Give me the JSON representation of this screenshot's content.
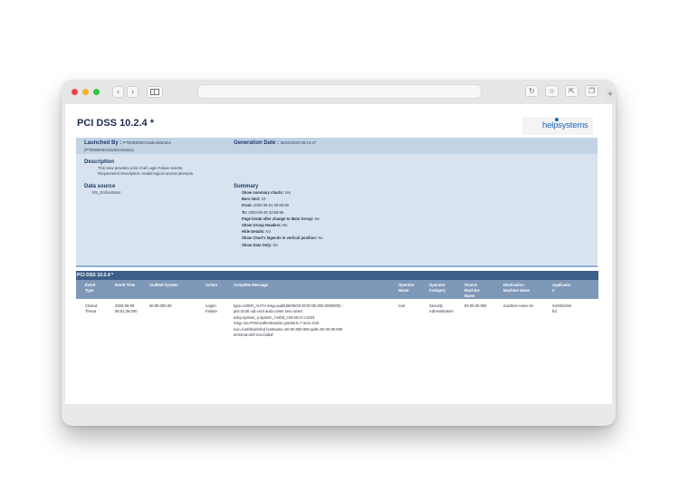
{
  "report": {
    "title": "PCI DSS 10.2.4 *",
    "logo_text": "helpsystems",
    "launched_by_label": "Launched By :",
    "launched_by_value": "PTEMDEMO1\\administrator",
    "launched_by_value2": "(PTEMDEMO1\\administrator)",
    "generation_date_label": "Generation Date :",
    "generation_date_value": "06/23/2020 09:14:47",
    "description_label": "Description",
    "description_lines": [
      "This view provides a list of all Login Failure events.",
      "Requirement Description: Invalid logical access attempts."
    ],
    "data_source_label": "Data source",
    "data_source_value": "RS_Orchestrator",
    "summary_label": "Summary",
    "summary": [
      {
        "k": "Show summary charts:",
        "v": "Yes"
      },
      {
        "k": "Bars limit:",
        "v": "10"
      },
      {
        "k": "From:",
        "v": "2020-06-01 00:00:00"
      },
      {
        "k": "To:",
        "v": "2020-06-30 23:59:59"
      },
      {
        "k": "Page break after change to Main Group:",
        "v": "No"
      },
      {
        "k": "Show Group Headers:",
        "v": "No"
      },
      {
        "k": "Hide Details:",
        "v": "No"
      },
      {
        "k": "Show Chart's legends in vertical position:",
        "v": "No"
      },
      {
        "k": "Show Data Only:",
        "v": "No"
      }
    ]
  },
  "table": {
    "section_title": "PCI DSS 10.2.4 *",
    "headers": {
      "event_type": [
        "Event",
        "Type"
      ],
      "event_time": [
        "Event Time"
      ],
      "audited_system": [
        "Audited System"
      ],
      "action": [
        "Action"
      ],
      "complete_message": [
        "Complete Message"
      ],
      "operator_name": [
        "Operator",
        "Name"
      ],
      "operator_category": [
        "Operator",
        "Category"
      ],
      "source_machine": [
        "Source",
        "Machine",
        "Name"
      ],
      "destination_machine": [
        "Destination",
        "Machine Name"
      ],
      "application": [
        "Applicatio",
        "n"
      ]
    },
    "row": {
      "event_type": [
        "Closed",
        "Threat"
      ],
      "event_time": [
        "2020-06-09",
        "06:51:36.000"
      ],
      "audited_system": [
        "00.00.000.00"
      ],
      "action": [
        "Logon",
        "Failure"
      ],
      "complete_message": [
        "type=USER_AUTH msg=audit(06/09/20 00:00:00.000.0000000) :",
        "pid=3136 uid=root auid=unset ses=unset",
        "subj=system_u:system_r:sshd_t:s0-s0:c0.c1023",
        "msg='op=PAM:authentication grantors=? acct=root",
        "exe=/usr/sbin/sshd hostname=00.00.000.000 addr=00.00.00.000",
        "terminal=ssh res=failed'"
      ],
      "operator_name": [
        "root"
      ],
      "operator_category": [
        "Security",
        "Administrators"
      ],
      "source_machine": [
        "00.00.00.000"
      ],
      "destination_machine": [
        "machine-name.hs"
      ],
      "application": [
        "/usr/sbin/ss",
        "hd"
      ]
    }
  }
}
